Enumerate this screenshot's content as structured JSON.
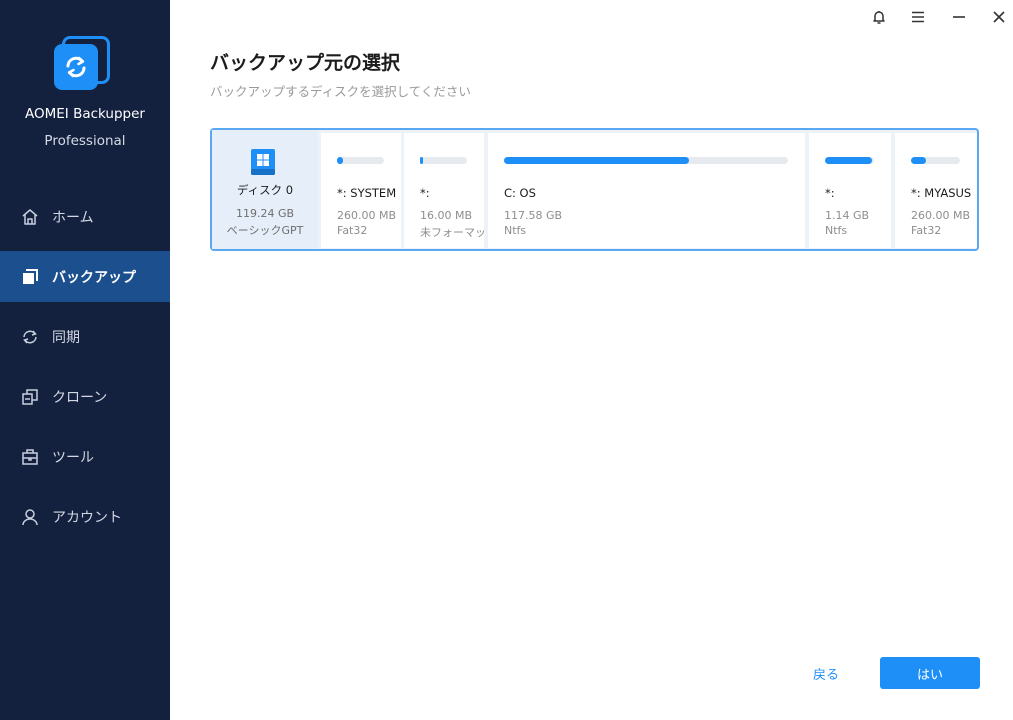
{
  "app": {
    "name": "AOMEI Backupper",
    "edition": "Professional",
    "logo_icon": "sync-copy-logo"
  },
  "window_controls": {
    "items": [
      {
        "name": "notifications",
        "icon": "bell-icon"
      },
      {
        "name": "menu",
        "icon": "menu-icon"
      },
      {
        "name": "minimize",
        "icon": "minimize-icon"
      },
      {
        "name": "close",
        "icon": "close-icon"
      }
    ]
  },
  "sidebar": {
    "items": [
      {
        "label": "ホーム",
        "icon": "home-icon",
        "active": false
      },
      {
        "label": "バックアップ",
        "icon": "backup-icon",
        "active": true
      },
      {
        "label": "同期",
        "icon": "sync-icon",
        "active": false
      },
      {
        "label": "クローン",
        "icon": "clone-icon",
        "active": false
      },
      {
        "label": "ツール",
        "icon": "toolbox-icon",
        "active": false
      },
      {
        "label": "アカウント",
        "icon": "user-icon",
        "active": false
      }
    ]
  },
  "main": {
    "title": "バックアップ元の選択",
    "subtitle": "バックアップするディスクを選択してください"
  },
  "disk": {
    "name": "ディスク 0",
    "size": "119.24 GB",
    "type": "ベーシックGPT",
    "icon": "windows-disk-icon",
    "partitions": [
      {
        "name": "*: SYSTEM",
        "size": "260.00 MB",
        "fs": "Fat32",
        "used_fraction": 0.12
      },
      {
        "name": "*:",
        "size": "16.00 MB",
        "fs": "未フォーマット",
        "used_fraction": 0.06
      },
      {
        "name": "C: OS",
        "size": "117.58 GB",
        "fs": "Ntfs",
        "used_fraction": 0.65
      },
      {
        "name": "*:",
        "size": "1.14 GB",
        "fs": "Ntfs",
        "used_fraction": 0.96
      },
      {
        "name": "*: MYASUS",
        "size": "260.00 MB",
        "fs": "Fat32",
        "used_fraction": 0.3
      }
    ]
  },
  "footer": {
    "back_label": "戻る",
    "confirm_label": "はい"
  },
  "colors": {
    "sidebar_bg": "#13213f",
    "sidebar_active": "#1b4f8d",
    "accent": "#1e8ff6"
  }
}
